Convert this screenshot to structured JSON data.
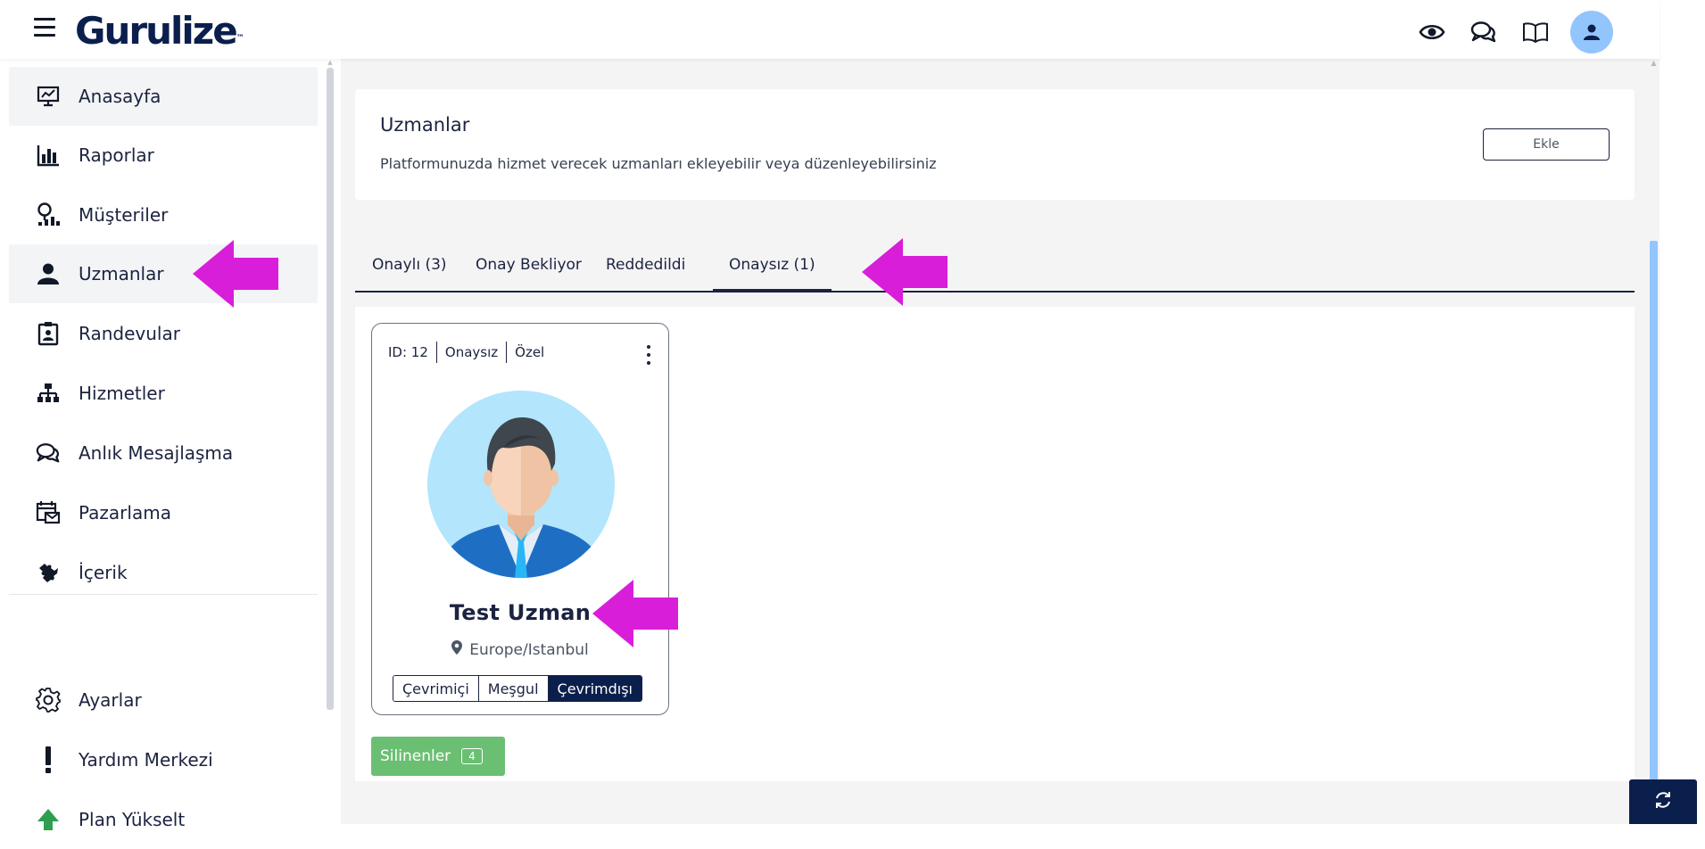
{
  "app": {
    "logo_text": "Gurulize",
    "logo_mark": "™"
  },
  "topbar": {
    "icons": [
      "eye-icon",
      "chat-icon",
      "book-icon",
      "user-avatar-icon"
    ]
  },
  "sidebar": {
    "items": [
      {
        "label": "Anasayfa",
        "icon": "presentation-chart-icon",
        "active": true
      },
      {
        "label": "Raporlar",
        "icon": "bar-chart-icon"
      },
      {
        "label": "Müşteriler",
        "icon": "customers-icon"
      },
      {
        "label": "Uzmanlar",
        "icon": "user-icon",
        "active": true
      },
      {
        "label": "Randevular",
        "icon": "clipboard-id-icon"
      },
      {
        "label": "Hizmetler",
        "icon": "sitemap-icon"
      },
      {
        "label": "Anlık Mesajlaşma",
        "icon": "chat-icon"
      },
      {
        "label": "Pazarlama",
        "icon": "calendar-mail-icon"
      },
      {
        "label": "İçerik",
        "icon": "puzzle-icon"
      }
    ],
    "bottom_items": [
      {
        "label": "Ayarlar",
        "icon": "gear-icon"
      },
      {
        "label": "Yardım Merkezi",
        "icon": "exclamation-icon"
      },
      {
        "label": "Plan Yükselt",
        "icon": "upgrade-arrow-icon"
      }
    ]
  },
  "header": {
    "title": "Uzmanlar",
    "subtitle": "Platformunuzda hizmet verecek uzmanları ekleyebilir veya düzenleyebilirsiniz",
    "add_button": "Ekle"
  },
  "tabs": [
    {
      "label": "Onaylı (3)"
    },
    {
      "label": "Onay Bekliyor"
    },
    {
      "label": "Reddedildi"
    },
    {
      "label": "Onaysız (1)",
      "active": true
    }
  ],
  "expert_card": {
    "id": "ID: 12",
    "approval": "Onaysız",
    "type": "Özel",
    "name": "Test Uzman",
    "location": "Europe/Istanbul",
    "statuses": [
      "Çevrimiçi",
      "Meşgul",
      "Çevrimdışı"
    ],
    "selected_status": "Çevrimdışı"
  },
  "deleted_button": {
    "label": "Silinenler",
    "count": "4"
  },
  "colors": {
    "navy": "#0b1f4d",
    "annotation_arrow": "#d91ed9",
    "green": "#6bbf73",
    "avatar_bg": "#b3e5fc",
    "scroll_accent": "#93c5fd"
  }
}
